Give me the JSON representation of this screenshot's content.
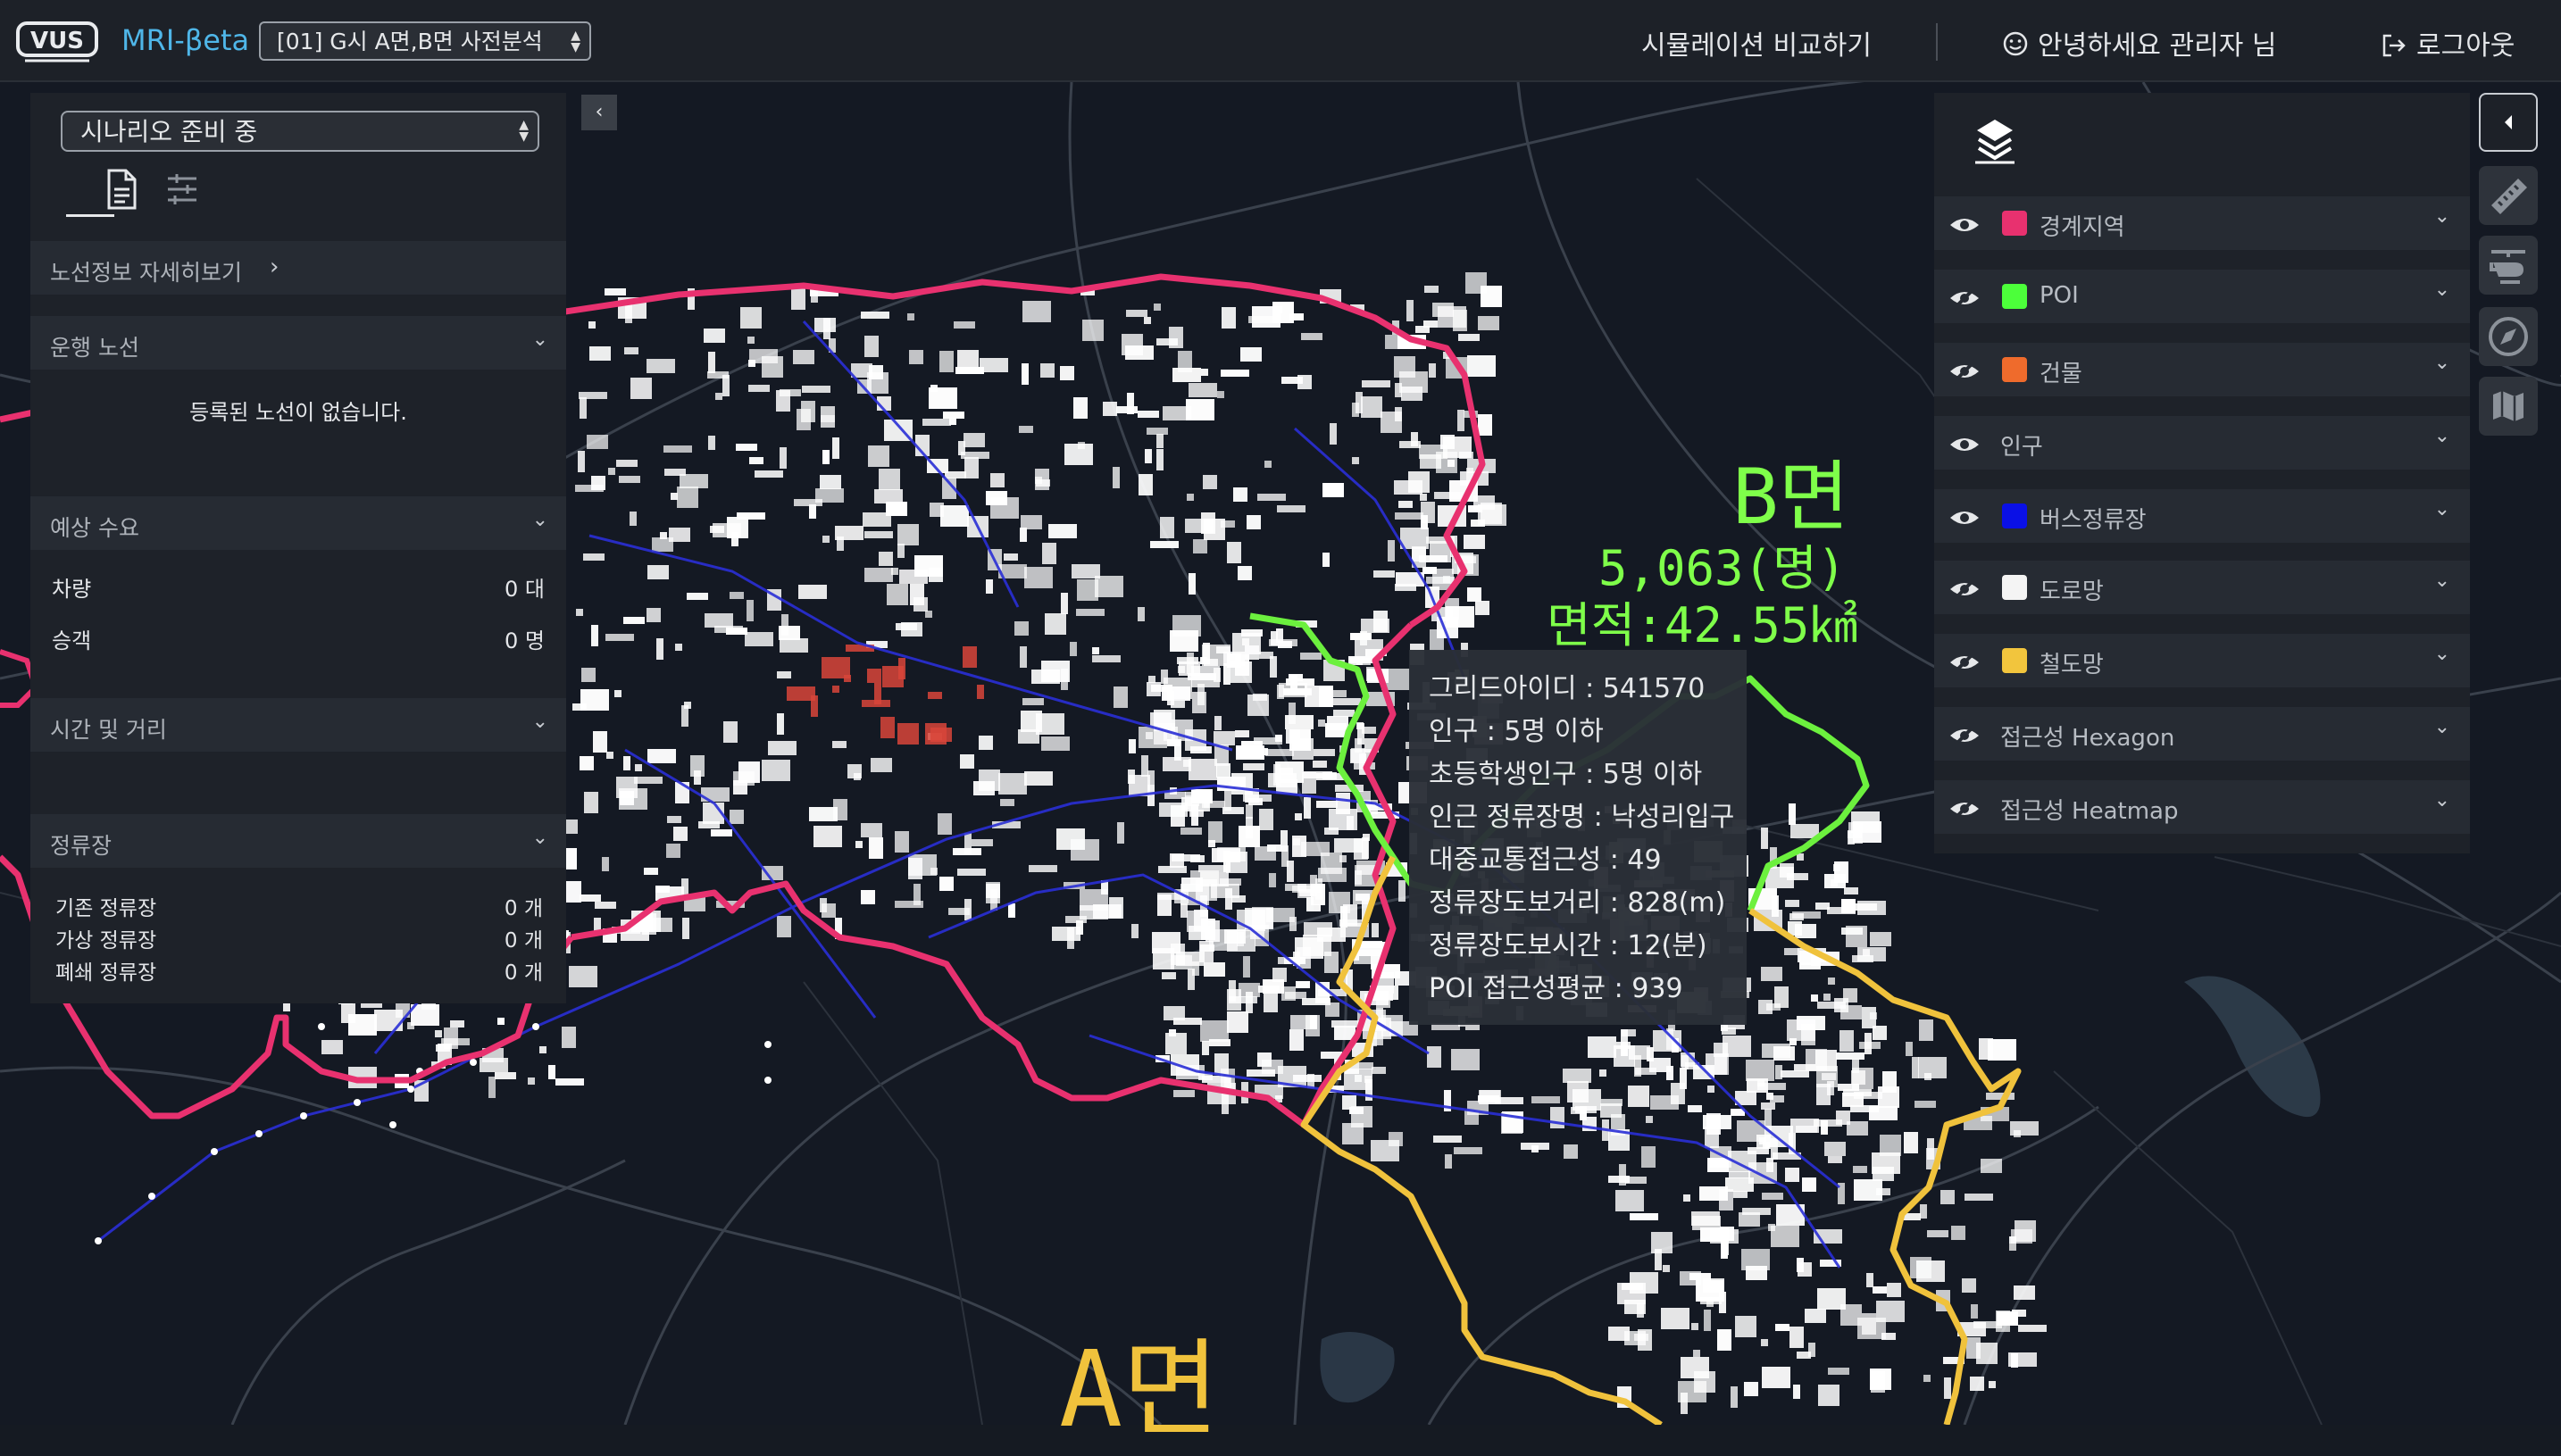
{
  "header": {
    "logo_text": "VUS",
    "app_name": "MRI-βeta",
    "scenario_selected": "[01] G시 A면,B면 사전분석",
    "nav_compare": "시뮬레이션 비교하기",
    "greeting": "안녕하세요 관리자 님",
    "logout": "로그아웃",
    "icons": [
      "smile-icon",
      "logout-icon"
    ]
  },
  "left_panel": {
    "scenario_status": "시나리오 준비 중",
    "tabs": [
      "document-icon",
      "sliders-icon"
    ],
    "route_detail_link": "노선정보 자세히보기",
    "sections": {
      "operation": {
        "title": "운행 노선",
        "empty_message": "등록된 노선이 없습니다."
      },
      "demand": {
        "title": "예상 수요",
        "rows": [
          {
            "label": "차량",
            "value": "0 대"
          },
          {
            "label": "승객",
            "value": "0 명"
          }
        ]
      },
      "time_distance": {
        "title": "시간 및 거리"
      },
      "stops": {
        "title": "정류장",
        "rows": [
          {
            "label": "기존 정류장",
            "value": "0 개"
          },
          {
            "label": "가상 정류장",
            "value": "0 개"
          },
          {
            "label": "폐쇄 정류장",
            "value": "0 개"
          }
        ]
      }
    }
  },
  "layers": {
    "items": [
      {
        "label": "경계지역",
        "color": "#e8316f",
        "visible": true
      },
      {
        "label": "POI",
        "color": "#4cff3a",
        "visible": false
      },
      {
        "label": "건물",
        "color": "#ef6b2c",
        "visible": false
      },
      {
        "label": "인구",
        "color": "",
        "visible": true
      },
      {
        "label": "버스정류장",
        "color": "#0a10e6",
        "visible": true
      },
      {
        "label": "도로망",
        "color": "#f4f4f4",
        "visible": false
      },
      {
        "label": "철도망",
        "color": "#f2c53d",
        "visible": false
      },
      {
        "label": "접근성 Hexagon",
        "color": "",
        "visible": false
      },
      {
        "label": "접근성 Heatmap",
        "color": "",
        "visible": false
      }
    ]
  },
  "tools": [
    "collapse-arrow-icon",
    "ruler-icon",
    "helicopter-icon",
    "compass-icon",
    "map-icon"
  ],
  "tooltip": {
    "lines": [
      "그리드아이디 : 541570",
      "인구 : 5명 이하",
      "초등학생인구 : 5명 이하",
      "인근 정류장명 : 낙성리입구",
      "대중교통접근성 : 49",
      "정류장도보거리 : 828(m)",
      "정류장도보시간 : 12(분)",
      "POI 접근성평균 : 939"
    ]
  },
  "map_labels": {
    "b_area": "B면",
    "b_population": "5,063(명)",
    "b_size": "면적:42.55㎢",
    "a_area": "A면"
  },
  "colors": {
    "boundary_main": "#e8316f",
    "boundary_b": "#6cf03e",
    "boundary_a": "#f0c23c",
    "population_grid": "#ffffff",
    "hotspot": "#d8453a",
    "bus_route": "#2a2fd6"
  }
}
